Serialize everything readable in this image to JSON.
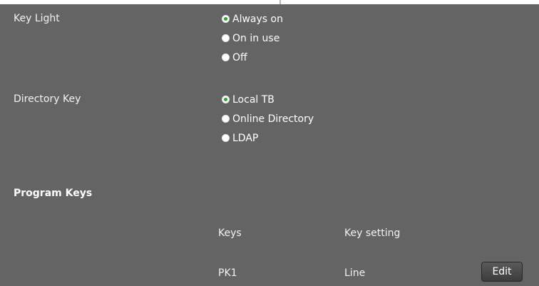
{
  "settings": {
    "key_light": {
      "label": "Key Light",
      "options": [
        "Always on",
        "On in use",
        "Off"
      ],
      "selected": "Always on"
    },
    "directory_key": {
      "label": "Directory Key",
      "options": [
        "Local TB",
        "Online Directory",
        "LDAP"
      ],
      "selected": "Local TB"
    }
  },
  "program_keys": {
    "title": "Program Keys",
    "columns": [
      "Keys",
      "Key setting"
    ],
    "rows": [
      {
        "key": "PK1",
        "setting": "Line",
        "action_label": "Edit"
      }
    ]
  }
}
